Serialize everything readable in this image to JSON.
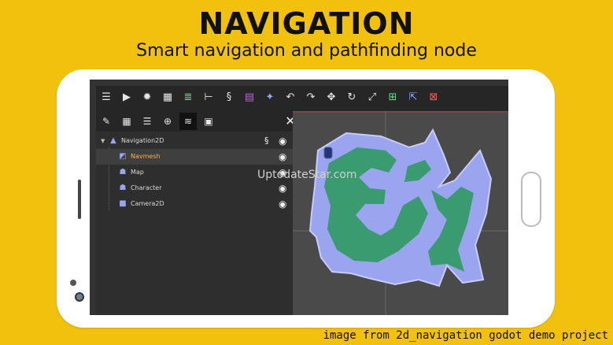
{
  "header": {
    "title": "NAVIGATION",
    "subtitle": "Smart navigation and pathfinding node"
  },
  "colors": {
    "background": "#F2C10E",
    "nav_fill": "#9aa4ef",
    "nav_inner": "#3a9a70",
    "selected_text": "#ffb04a"
  },
  "toolbar": {
    "icons": [
      "menu-icon",
      "play-icon",
      "debug-icon",
      "clapperboard-icon",
      "list-green-icon",
      "tree-icon",
      "script-icon",
      "film-icon",
      "puzzle-icon",
      "undo-icon",
      "redo-icon",
      "move-icon",
      "rotate-icon",
      "scale-icon",
      "add-node-icon",
      "pointer-add-icon",
      "delete-node-icon"
    ]
  },
  "scene_toolbar": {
    "icons": [
      "pencil-icon",
      "scene-add-icon",
      "list-icon",
      "node-add-icon",
      "signal-icon",
      "record-icon"
    ],
    "close_icon": "close-icon"
  },
  "scene_tree": {
    "root": {
      "label": "Navigation2D"
    },
    "children": [
      {
        "label": "Navmesh",
        "selected": true,
        "icon": "navmesh-icon"
      },
      {
        "label": "Map",
        "selected": false,
        "icon": "tilemap-icon"
      },
      {
        "label": "Character",
        "selected": false,
        "icon": "character-icon"
      },
      {
        "label": "Camera2D",
        "selected": false,
        "icon": "camera-icon"
      }
    ]
  },
  "watermark": "UptodateStar.com",
  "credit": "image from 2d_navigation godot demo project"
}
